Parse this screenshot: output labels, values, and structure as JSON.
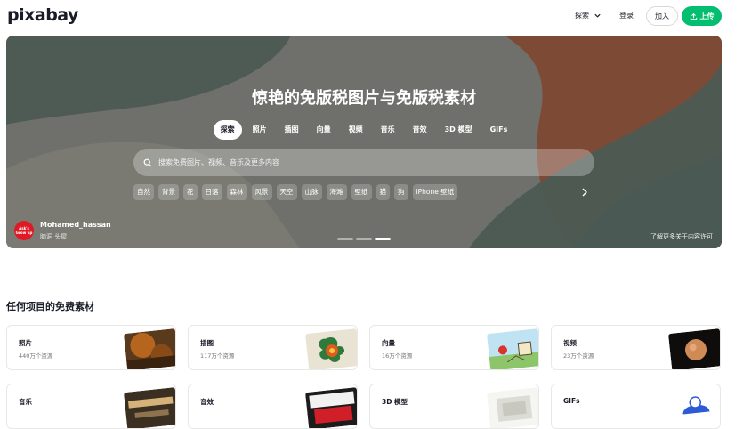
{
  "header": {
    "logo": "pixabay",
    "explore_label": "探索",
    "login_label": "登录",
    "join_label": "加入",
    "upload_label": "上传"
  },
  "hero": {
    "title": "惊艳的免版税图片与免版税素材",
    "tabs": [
      {
        "label": "探索",
        "active": true
      },
      {
        "label": "照片"
      },
      {
        "label": "插图"
      },
      {
        "label": "向量"
      },
      {
        "label": "视频"
      },
      {
        "label": "音乐"
      },
      {
        "label": "音效"
      },
      {
        "label": "3D 模型"
      },
      {
        "label": "GIFs"
      }
    ],
    "search_placeholder": "搜索免费图片、视频、音乐及更多内容",
    "chips": [
      "自然",
      "背景",
      "花",
      "日落",
      "森林",
      "风景",
      "天空",
      "山脉",
      "海滩",
      "壁纸",
      "猫",
      "狗",
      "iPhone 壁纸"
    ],
    "author": {
      "name": "Mohamed_hassan",
      "subtitle": "脑洞 头屋",
      "avatar_text": "Ask's Grow up"
    },
    "learn_more": "了解更多关于内容许可",
    "slide_count": 3,
    "active_slide": 3
  },
  "section": {
    "title": "任何项目的免费素材",
    "cards": [
      {
        "title": "照片",
        "count": "440万个资源"
      },
      {
        "title": "插图",
        "count": "117万个资源"
      },
      {
        "title": "向量",
        "count": "16万个资源"
      },
      {
        "title": "视频",
        "count": "23万个资源"
      },
      {
        "title": "音乐",
        "count": ""
      },
      {
        "title": "音效",
        "count": ""
      },
      {
        "title": "3D 模型",
        "count": ""
      },
      {
        "title": "GIFs",
        "count": ""
      }
    ]
  },
  "colors": {
    "accent": "#02be6e",
    "hero_dark": "#4c5a54",
    "hero_rust": "#7d4a36",
    "text": "#191b26"
  },
  "icons": [
    "chevron-down-icon",
    "upload-icon",
    "search-icon",
    "chevron-right-icon"
  ]
}
